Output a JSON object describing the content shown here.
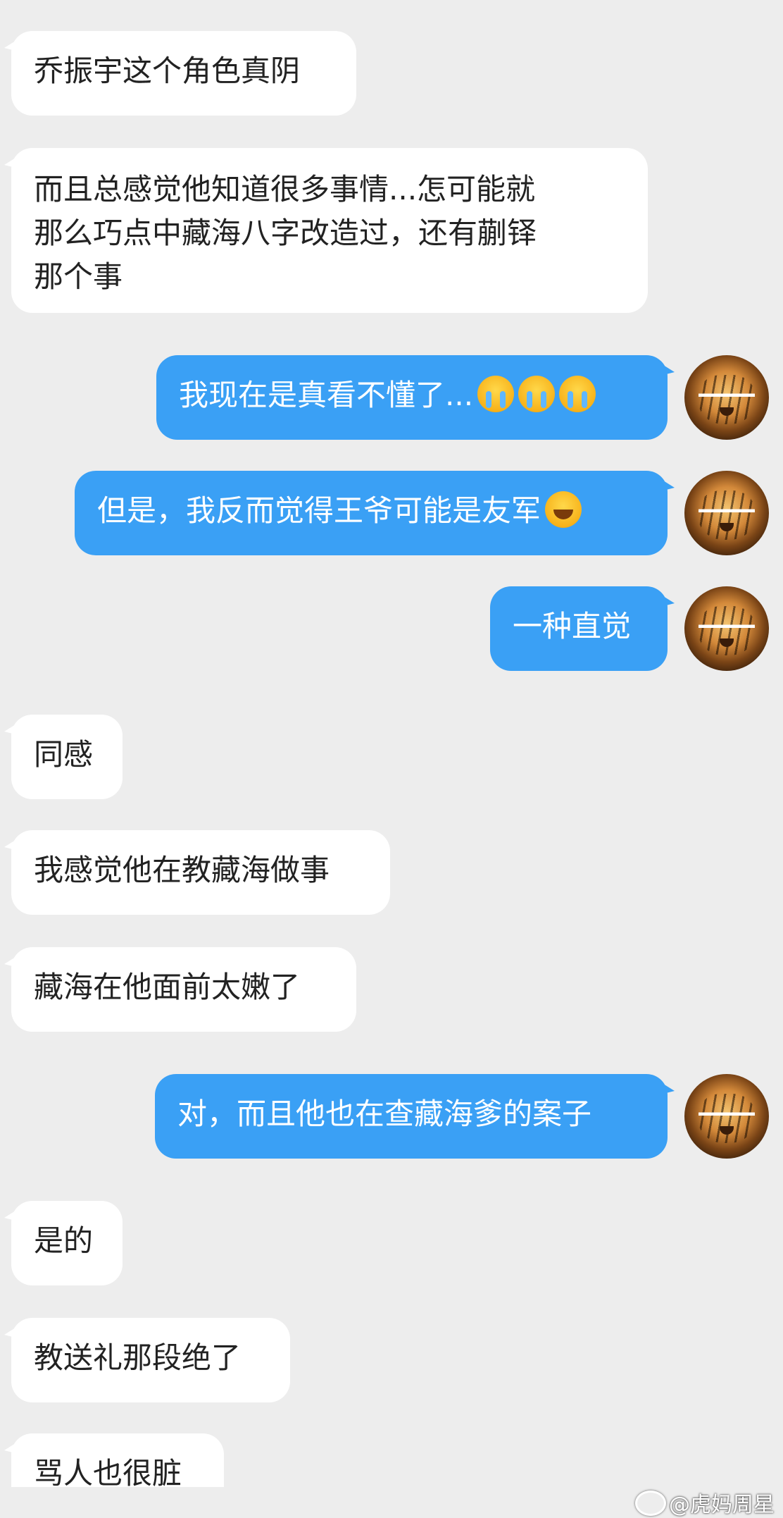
{
  "messages": [
    {
      "side": "left",
      "text": "乔振宇这个角色真阴"
    },
    {
      "side": "left",
      "lines": [
        "而且总感觉他知道很多事情...怎可能就",
        "那么巧点中藏海八字改造过，还有蒯铎",
        "那个事"
      ]
    },
    {
      "side": "right",
      "text": "我现在是真看不懂了...",
      "emojis": [
        "loudly-crying-face",
        "loudly-crying-face",
        "loudly-crying-face"
      ]
    },
    {
      "side": "right",
      "text": "但是，我反而觉得王爷可能是友军",
      "emojis": [
        "rolling-laughing-face"
      ]
    },
    {
      "side": "right",
      "text": "一种直觉"
    },
    {
      "side": "left",
      "text": "同感"
    },
    {
      "side": "left",
      "text": "我感觉他在教藏海做事"
    },
    {
      "side": "left",
      "text": "藏海在他面前太嫩了"
    },
    {
      "side": "right",
      "text": "对，而且他也在查藏海爹的案子"
    },
    {
      "side": "left",
      "text": "是的"
    },
    {
      "side": "left",
      "text": "教送礼那段绝了"
    },
    {
      "side": "left",
      "text": "骂人也很脏"
    }
  ],
  "avatar_icon": "tiger-avatar-icon",
  "watermark": "@虎妈周星",
  "colors": {
    "background": "#ededed",
    "sent_bubble": "#3aa0f5",
    "received_bubble": "#ffffff"
  }
}
